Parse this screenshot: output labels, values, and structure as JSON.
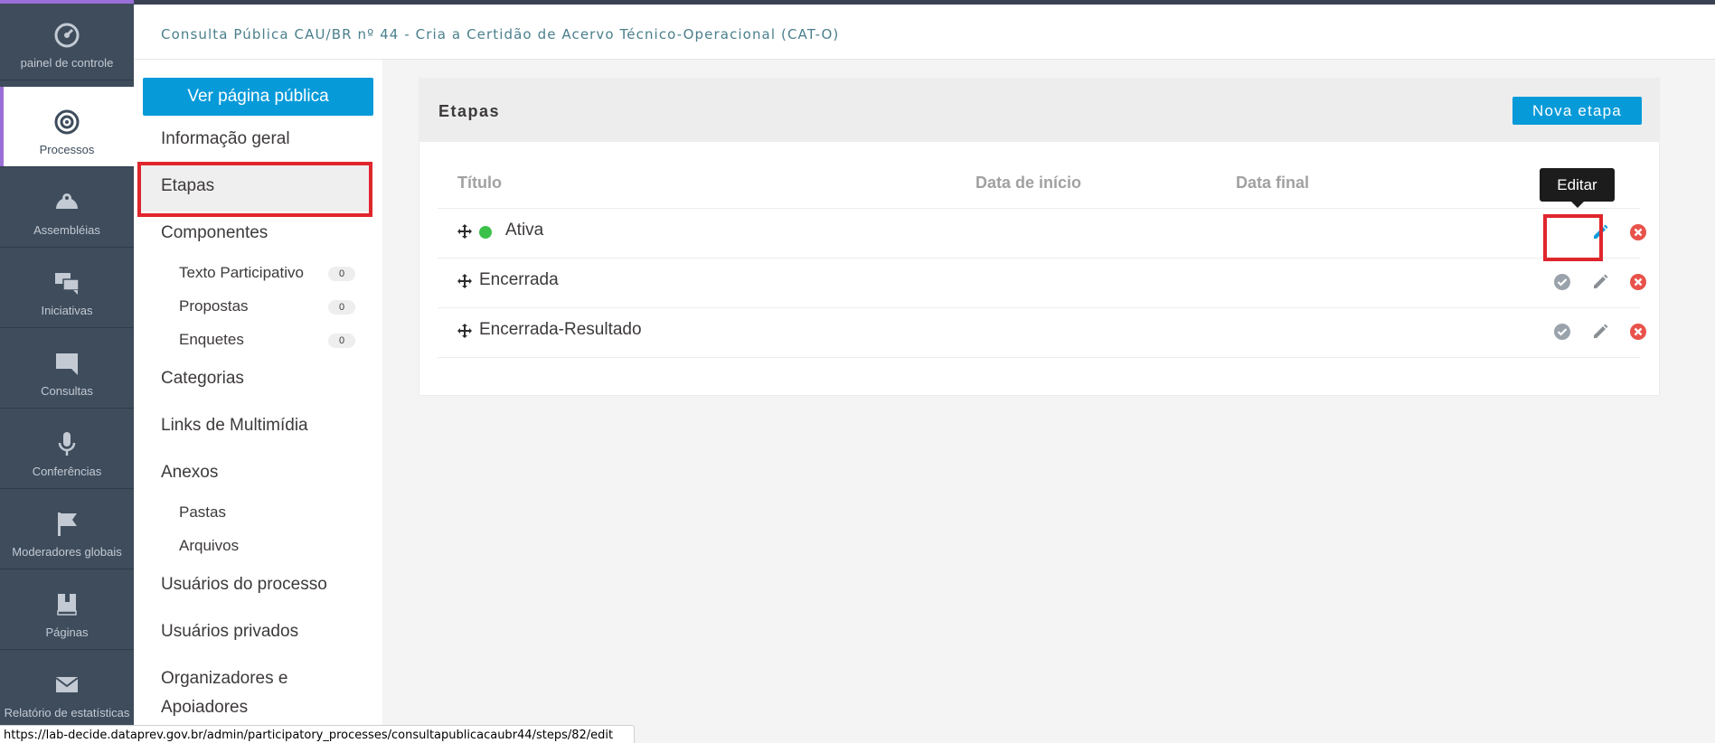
{
  "colors": {
    "rail_bg": "#3e4c5c",
    "accent_purple": "#9a6fd8",
    "primary_blue": "#079ad9",
    "active_dot_green": "#3bc14a",
    "danger_red": "#e0262d"
  },
  "rail": {
    "items": [
      {
        "label": "painel de controle",
        "icon": "dashboard-icon"
      },
      {
        "label": "Processos",
        "icon": "target-icon"
      },
      {
        "label": "Assembléias",
        "icon": "assemblies-icon"
      },
      {
        "label": "Iniciativas",
        "icon": "chat-bubbles-icon"
      },
      {
        "label": "Consultas",
        "icon": "comment-icon"
      },
      {
        "label": "Conferências",
        "icon": "microphone-icon"
      },
      {
        "label": "Moderadores globais",
        "icon": "flag-icon"
      },
      {
        "label": "Páginas",
        "icon": "book-icon"
      },
      {
        "label": "Relatório de estatísticas",
        "icon": "envelope-icon"
      }
    ]
  },
  "header": {
    "breadcrumb": "Consulta Pública CAU/BR nº 44 - Cria a Certidão de Acervo Técnico-Operacional (CAT-O)"
  },
  "subnav": {
    "public_button": "Ver página pública",
    "items": {
      "general": "Informação geral",
      "steps": "Etapas",
      "components": "Componentes",
      "participatory_text": "Texto Participativo",
      "participatory_text_count": "0",
      "proposals": "Propostas",
      "proposals_count": "0",
      "surveys": "Enquetes",
      "surveys_count": "0",
      "categories": "Categorias",
      "multimedia": "Links de Multimídia",
      "attachments": "Anexos",
      "folders": "Pastas",
      "files": "Arquivos",
      "process_users": "Usuários do processo",
      "private_users": "Usuários privados",
      "organizers_line1": "Organizadores e",
      "organizers_line2": "Apoiadores"
    }
  },
  "main": {
    "title": "Etapas",
    "new_button": "Nova etapa",
    "columns": {
      "title": "Título",
      "start": "Data de início",
      "end": "Data final"
    },
    "rows": [
      {
        "title": "Ativa",
        "active": true
      },
      {
        "title": "Encerrada",
        "active": false
      },
      {
        "title": "Encerrada-Resultado",
        "active": false
      }
    ],
    "tooltip": "Editar"
  },
  "status_bar": {
    "url": "https://lab-decide.dataprev.gov.br/admin/participatory_processes/consultapublicacaubr44/steps/82/edit"
  }
}
